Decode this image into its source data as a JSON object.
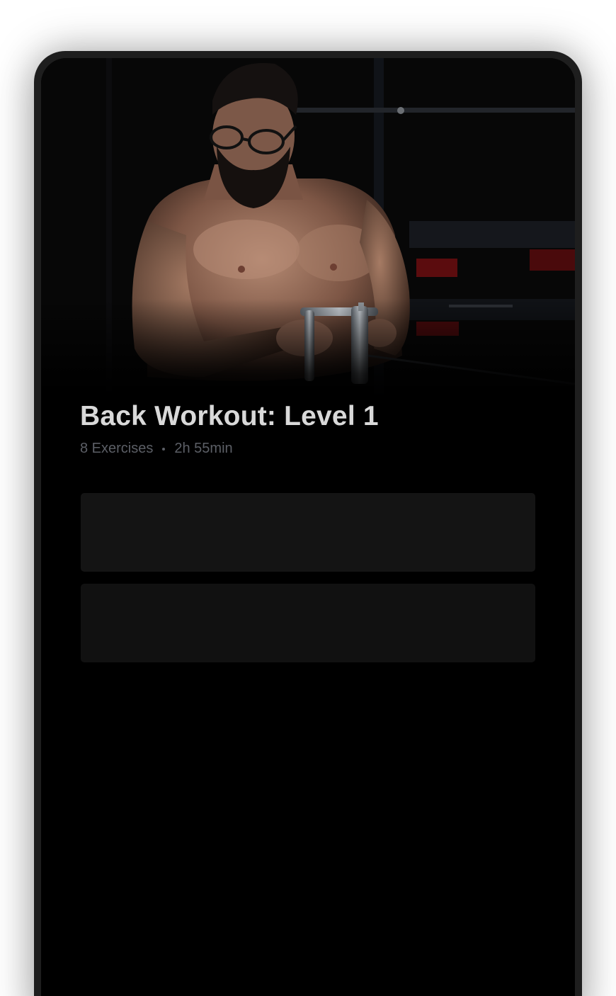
{
  "workout": {
    "title": "Back Workout: Level 1",
    "exercise_count": "8 Exercises",
    "duration": "2h 55min"
  },
  "hero_image": {
    "subject": "bearded man with glasses pulling a cable handle in a dark gym"
  },
  "colors": {
    "background": "#000000",
    "device_frame": "#1e1e1e",
    "title_text": "#d9d9d9",
    "meta_text": "#5c5f66",
    "card": "#141414"
  },
  "exercise_cards": [
    {
      "id": "card-1"
    },
    {
      "id": "card-2"
    }
  ]
}
